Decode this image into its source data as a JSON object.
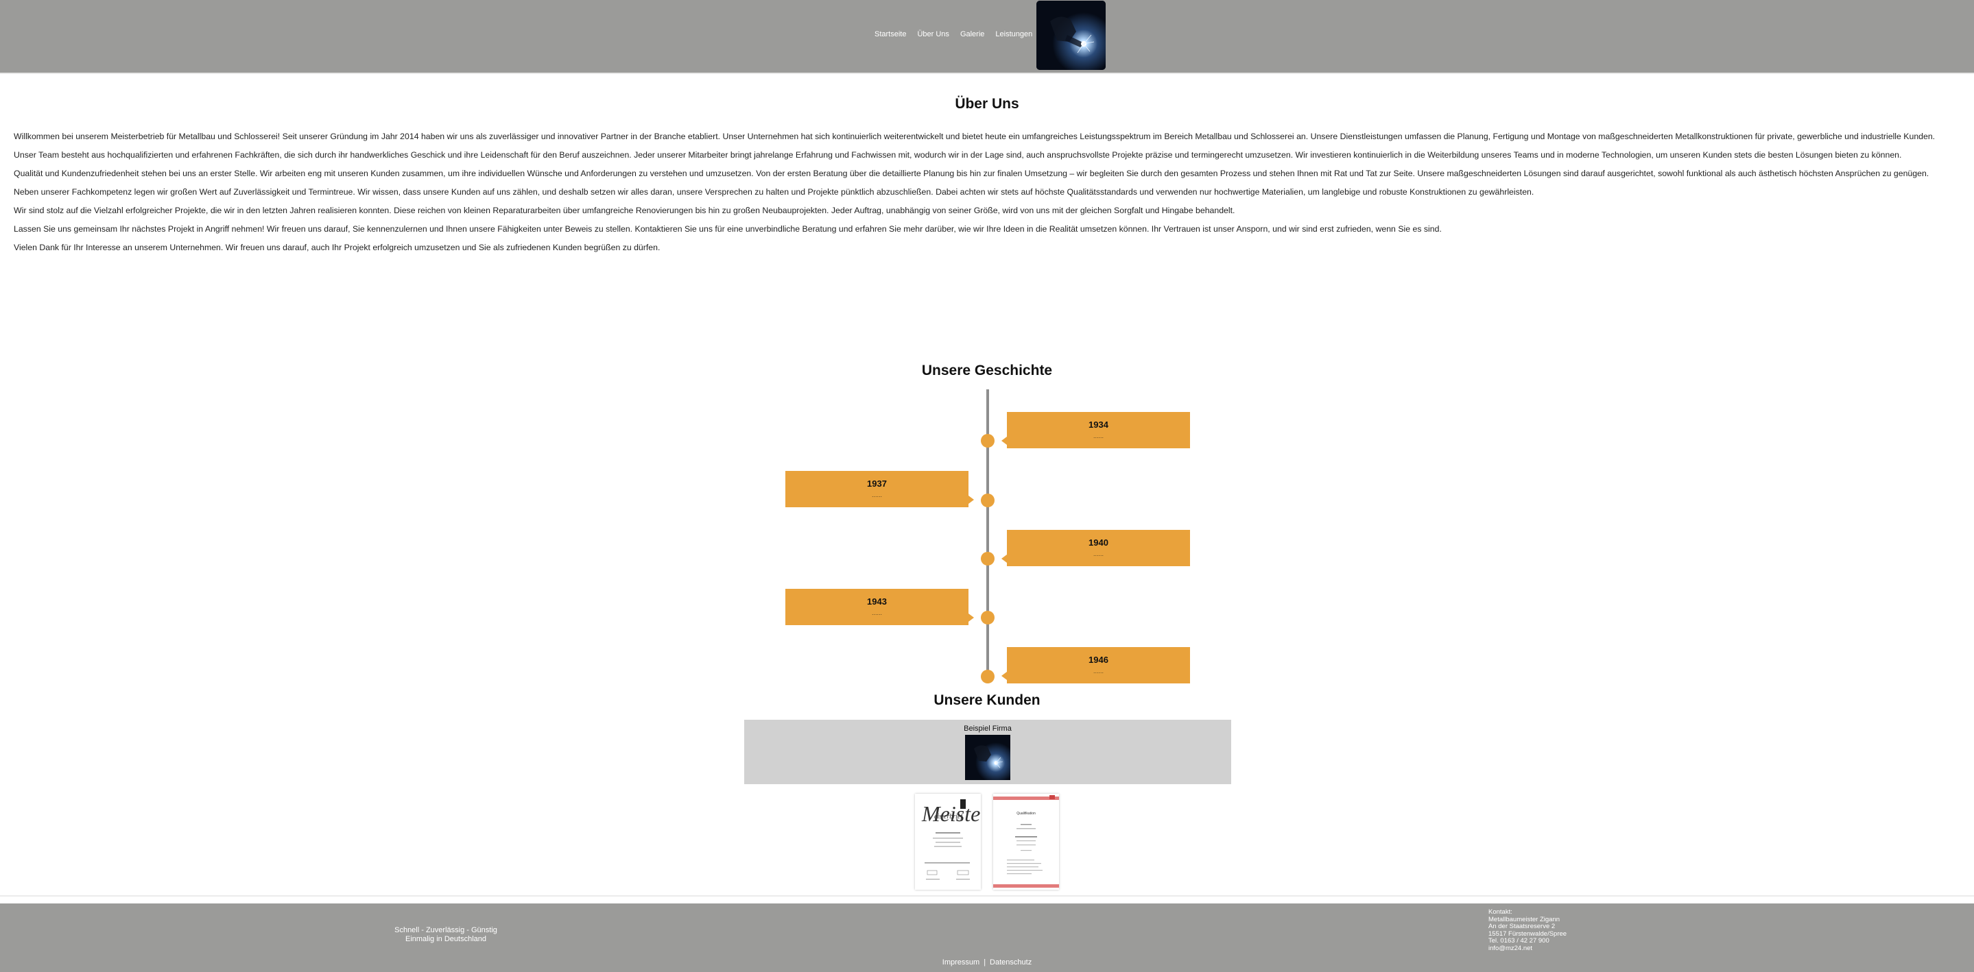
{
  "nav": {
    "items": [
      "Startseite",
      "Über Uns",
      "Galerie",
      "Leistungen"
    ]
  },
  "about": {
    "title": "Über Uns",
    "paragraphs": [
      "Willkommen bei unserem Meisterbetrieb für Metallbau und Schlosserei! Seit unserer Gründung im Jahr 2014 haben wir uns als zuverlässiger und innovativer Partner in der Branche etabliert. Unser Unternehmen hat sich kontinuierlich weiterentwickelt und bietet heute ein umfangreiches Leistungsspektrum im Bereich Metallbau und Schlosserei an. Unsere Dienstleistungen umfassen die Planung, Fertigung und Montage von maßgeschneiderten Metallkonstruktionen für private, gewerbliche und industrielle Kunden.",
      "Unser Team besteht aus hochqualifizierten und erfahrenen Fachkräften, die sich durch ihr handwerkliches Geschick und ihre Leidenschaft für den Beruf auszeichnen. Jeder unserer Mitarbeiter bringt jahrelange Erfahrung und Fachwissen mit, wodurch wir in der Lage sind, auch anspruchsvollste Projekte präzise und termingerecht umzusetzen. Wir investieren kontinuierlich in die Weiterbildung unseres Teams und in moderne Technologien, um unseren Kunden stets die besten Lösungen bieten zu können.",
      "Qualität und Kundenzufriedenheit stehen bei uns an erster Stelle. Wir arbeiten eng mit unseren Kunden zusammen, um ihre individuellen Wünsche und Anforderungen zu verstehen und umzusetzen. Von der ersten Beratung über die detaillierte Planung bis hin zur finalen Umsetzung – wir begleiten Sie durch den gesamten Prozess und stehen Ihnen mit Rat und Tat zur Seite. Unsere maßgeschneiderten Lösungen sind darauf ausgerichtet, sowohl funktional als auch ästhetisch höchsten Ansprüchen zu genügen.",
      "Neben unserer Fachkompetenz legen wir großen Wert auf Zuverlässigkeit und Termintreue. Wir wissen, dass unsere Kunden auf uns zählen, und deshalb setzen wir alles daran, unsere Versprechen zu halten und Projekte pünktlich abzuschließen. Dabei achten wir stets auf höchste Qualitätsstandards und verwenden nur hochwertige Materialien, um langlebige und robuste Konstruktionen zu gewährleisten.",
      "Wir sind stolz auf die Vielzahl erfolgreicher Projekte, die wir in den letzten Jahren realisieren konnten. Diese reichen von kleinen Reparaturarbeiten über umfangreiche Renovierungen bis hin zu großen Neubauprojekten. Jeder Auftrag, unabhängig von seiner Größe, wird von uns mit der gleichen Sorgfalt und Hingabe behandelt.",
      "Lassen Sie uns gemeinsam Ihr nächstes Projekt in Angriff nehmen! Wir freuen uns darauf, Sie kennenzulernen und Ihnen unsere Fähigkeiten unter Beweis zu stellen. Kontaktieren Sie uns für eine unverbindliche Beratung und erfahren Sie mehr darüber, wie wir Ihre Ideen in die Realität umsetzen können. Ihr Vertrauen ist unser Ansporn, und wir sind erst zufrieden, wenn Sie es sind.",
      "Vielen Dank für Ihr Interesse an unserem Unternehmen. Wir freuen uns darauf, auch Ihr Projekt erfolgreich umzusetzen und Sie als zufriedenen Kunden begrüßen zu dürfen."
    ]
  },
  "history": {
    "title": "Unsere Geschichte",
    "events": [
      {
        "year": "1934",
        "text": "......",
        "side": "right"
      },
      {
        "year": "1937",
        "text": "......",
        "side": "left"
      },
      {
        "year": "1940",
        "text": "......",
        "side": "right"
      },
      {
        "year": "1943",
        "text": "......",
        "side": "left"
      },
      {
        "year": "1946",
        "text": "......",
        "side": "right"
      }
    ]
  },
  "customers": {
    "title": "Unsere Kunden",
    "items": [
      {
        "name": "Beispiel Firma"
      }
    ],
    "documents": [
      {
        "heading": "Meisterbrief"
      },
      {
        "heading": "Qualifikation"
      }
    ]
  },
  "footer": {
    "slogan_line1": "Schnell - Zuverlässig - Günstig",
    "slogan_line2": "Einmalig in Deutschland",
    "contact": [
      "Kontakt:",
      "Metallbaumeister Zigann",
      "An der Staatsreserve 2",
      "15517 Fürstenwalde/Spree",
      "Tel. 0163 / 42 27 900",
      "info@mz24.net"
    ],
    "impressum": "Impressum",
    "separator": "|",
    "datenschutz": "Datenschutz"
  },
  "colors": {
    "header_bg": "#9b9b99",
    "accent": "#e9a23b",
    "timeline_line": "#8e8e8e",
    "customer_box": "#d1d1d1"
  }
}
